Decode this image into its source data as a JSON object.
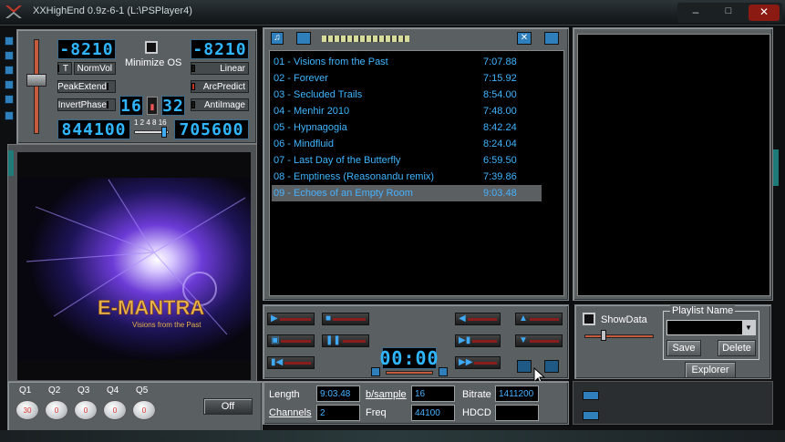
{
  "window": {
    "title": "XXHighEnd 0.9z-6-1 (L:\\PSPlayer4)"
  },
  "left": {
    "lcd_top_left": "-8210",
    "lcd_top_right": "-8210",
    "minimize_os_label": "Minimize OS",
    "opt_t": "T",
    "opt_normvol": "NormVol",
    "opt_linear": "Linear",
    "opt_peakextend": "PeakExtend",
    "opt_arcpredict": "ArcPredict",
    "opt_invertphase": "InvertPhase",
    "opt_antiimage": "AntiImage",
    "bits_left": "16",
    "bits_right": "32",
    "rate_left": "844100",
    "rate_right": "705600",
    "slider_scale": "1 2 4 8 16",
    "album_art_title": "E-MANTRA",
    "album_art_subtitle": "Visions from the Past"
  },
  "playlist": {
    "tracks": [
      {
        "title": "01 - Visions from the Past",
        "duration": "7:07.88"
      },
      {
        "title": "02 - Forever",
        "duration": "7:15.92"
      },
      {
        "title": "03 - Secluded Trails",
        "duration": "8:54.00"
      },
      {
        "title": "04 - Menhir 2010",
        "duration": "7:48.00"
      },
      {
        "title": "05 - Hypnagogia",
        "duration": "8:42.24"
      },
      {
        "title": "06 - Mindfluid",
        "duration": "8:24.04"
      },
      {
        "title": "07 - Last Day of the Butterfly",
        "duration": "6:59.50"
      },
      {
        "title": "08 - Emptiness (Reasonandu remix)",
        "duration": "7:39.86"
      },
      {
        "title": "09 - Echoes of an Empty Room",
        "duration": "9:03.48"
      }
    ],
    "selected_index": 8
  },
  "transport": {
    "time_display": "00:00"
  },
  "right": {
    "show_data_label": "ShowData",
    "playlist_name_label": "Playlist Name",
    "playlist_name_value": "",
    "save_label": "Save",
    "delete_label": "Delete",
    "explorer_label": "Explorer"
  },
  "eq": {
    "labels": [
      "Q1",
      "Q2",
      "Q3",
      "Q4",
      "Q5"
    ],
    "values": [
      "30",
      "0",
      "0",
      "0",
      "0"
    ],
    "off_label": "Off"
  },
  "info": {
    "length_label": "Length",
    "length_value": "9:03.48",
    "bsample_label": "b/sample",
    "bsample_value": "16",
    "bitrate_label": "Bitrate",
    "bitrate_value": "1411200",
    "channels_label": "Channels",
    "channels_value": "2",
    "freq_label": "Freq",
    "freq_value": "44100",
    "hdcd_label": "HDCD",
    "hdcd_value": ""
  },
  "colors": {
    "accent": "#3fb6ff",
    "panel": "#5a5f62",
    "lcd_bg": "#000000"
  }
}
